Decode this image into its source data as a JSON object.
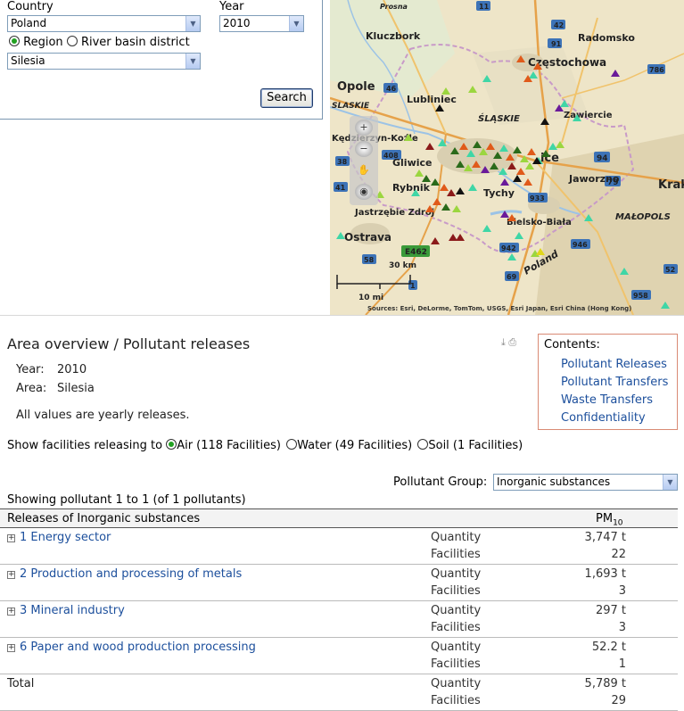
{
  "form": {
    "country_label": "Country",
    "country_value": "Poland",
    "year_label": "Year",
    "year_value": "2010",
    "radio_region": "Region",
    "radio_river": "River basin district",
    "region_value": "Silesia",
    "search_label": "Search"
  },
  "map": {
    "places": [
      "Kluczbork",
      "Radomsko",
      "Częstochowa",
      "Opole",
      "Lubliniec",
      "Zawiercie",
      "Kędzierzyn-Koźle",
      "Gliwice",
      "Rybnik",
      "Tychy",
      "Jaworzno",
      "Jastrzębie Zdrój",
      "Bielsko-Biała",
      "Ostrava",
      "Krak",
      "ŚLĄSKIE",
      "MAŁOPOLS",
      "Prosna",
      "Poland",
      "SLASKIE",
      "ice"
    ],
    "road_numbers": [
      "11",
      "42",
      "91",
      "786",
      "46",
      "408",
      "94",
      "79",
      "38",
      "41",
      "933",
      "942",
      "946",
      "958",
      "52",
      "58",
      "69",
      "E462",
      "1",
      "38"
    ],
    "scale_km": "30 km",
    "scale_mi": "10 mi",
    "attribution": "Sources: Esri, DeLorme, TomTom, USGS, Esri Japan, Esri China (Hong Kong)"
  },
  "overview": {
    "title": "Area overview / Pollutant releases",
    "year_label": "Year:",
    "year_value": "2010",
    "area_label": "Area:",
    "area_value": "Silesia",
    "note": "All values are yearly releases."
  },
  "contents": {
    "heading": "Contents:",
    "links": [
      "Pollutant Releases",
      "Pollutant Transfers",
      "Waste Transfers",
      "Confidentiality"
    ]
  },
  "show": {
    "label": "Show facilities releasing to",
    "air": "Air (118 Facilities)",
    "water": "Water (49 Facilities)",
    "soil": "Soil (1 Facilities)"
  },
  "pollutant_group": {
    "label": "Pollutant Group:",
    "value": "Inorganic substances"
  },
  "showing_text": "Showing pollutant 1 to 1 (of 1 pollutants)",
  "table": {
    "header": "Releases of Inorganic substances",
    "column": "PM",
    "column_sub": "10",
    "quantity_label": "Quantity",
    "facilities_label": "Facilities",
    "rows": [
      {
        "name": "1 Energy sector",
        "quantity": "3,747 t",
        "facilities": "22"
      },
      {
        "name": "2 Production and processing of metals",
        "quantity": "1,693 t",
        "facilities": "3"
      },
      {
        "name": "3 Mineral industry",
        "quantity": "297 t",
        "facilities": "3"
      },
      {
        "name": "6 Paper and wood production processing",
        "quantity": "52.2 t",
        "facilities": "1"
      }
    ],
    "total": {
      "name": "Total",
      "quantity": "5,789 t",
      "facilities": "29"
    }
  },
  "colors": {
    "link": "#1c4f9c",
    "contents_border": "#d98a74",
    "radio_on": "#21a121"
  }
}
